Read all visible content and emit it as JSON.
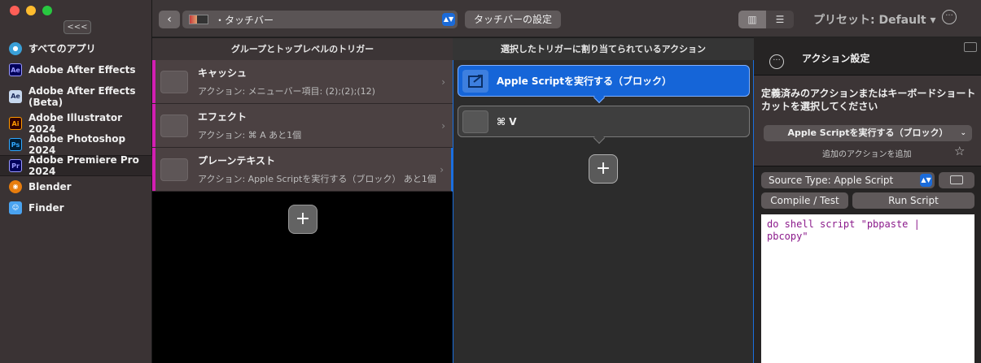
{
  "sidebar": {
    "collapse_label": "<<<",
    "apps": [
      {
        "name": "すべてのアプリ",
        "icon": "globe-icon",
        "color": "#3aa0d8",
        "badge": ""
      },
      {
        "name": "Adobe After Effects",
        "icon": "after-effects-icon",
        "color": "#00005b",
        "badge": "Ae"
      },
      {
        "name": "Adobe After Effects (Beta)",
        "icon": "after-effects-beta-icon",
        "color": "#c7d8ef",
        "badge": "Ae"
      },
      {
        "name": "Adobe Illustrator 2024",
        "icon": "illustrator-icon",
        "color": "#330000",
        "badge": "Ai"
      },
      {
        "name": "Adobe Photoshop 2024",
        "icon": "photoshop-icon",
        "color": "#001e36",
        "badge": "Ps"
      },
      {
        "name": "Adobe Premiere Pro 2024",
        "icon": "premiere-icon",
        "color": "#00005b",
        "badge": "Pr"
      },
      {
        "name": "Blender",
        "icon": "blender-icon",
        "color": "#e87d0d",
        "badge": ""
      },
      {
        "name": "Finder",
        "icon": "finder-icon",
        "color": "#4aa3f0",
        "badge": ""
      }
    ]
  },
  "toolbar": {
    "back_label": "‹",
    "bar_select": "・タッチバー",
    "settings_button": "タッチバーの設定",
    "preset": "プリセット: Default ▾",
    "more_label": "···"
  },
  "triggers": {
    "header": "グループとトップレベルのトリガー",
    "items": [
      {
        "title": "キャッシュ",
        "subtitle": "アクション: メニューバー項目: (2);(2);(12)"
      },
      {
        "title": "エフェクト",
        "subtitle": "アクション: ⌘ A あと1個"
      },
      {
        "title": "プレーンテキスト",
        "subtitle": "アクション: Apple Scriptを実行する（ブロック） あと1個"
      }
    ],
    "add_label": "+"
  },
  "actions": {
    "header": "選択したトリガーに割り当てられているアクション",
    "items": [
      {
        "label": "Apple Scriptを実行する（ブロック）"
      },
      {
        "label": "⌘ V"
      }
    ],
    "add_label": "+"
  },
  "settings_panel": {
    "title": "アクション設定",
    "description": "定義済みのアクションまたはキーボードショートカットを選択してください",
    "action_select": "Apple Scriptを実行する（ブロック）",
    "add_more": "追加のアクションを追加",
    "source_type": "Source Type: Apple Script",
    "compile_button": "Compile / Test",
    "run_button": "Run Script",
    "script_text": "do shell script \"pbpaste |\npbcopy\""
  },
  "colors": {
    "accent": "#1565d8",
    "trigger_marker": "#d21fb2"
  }
}
